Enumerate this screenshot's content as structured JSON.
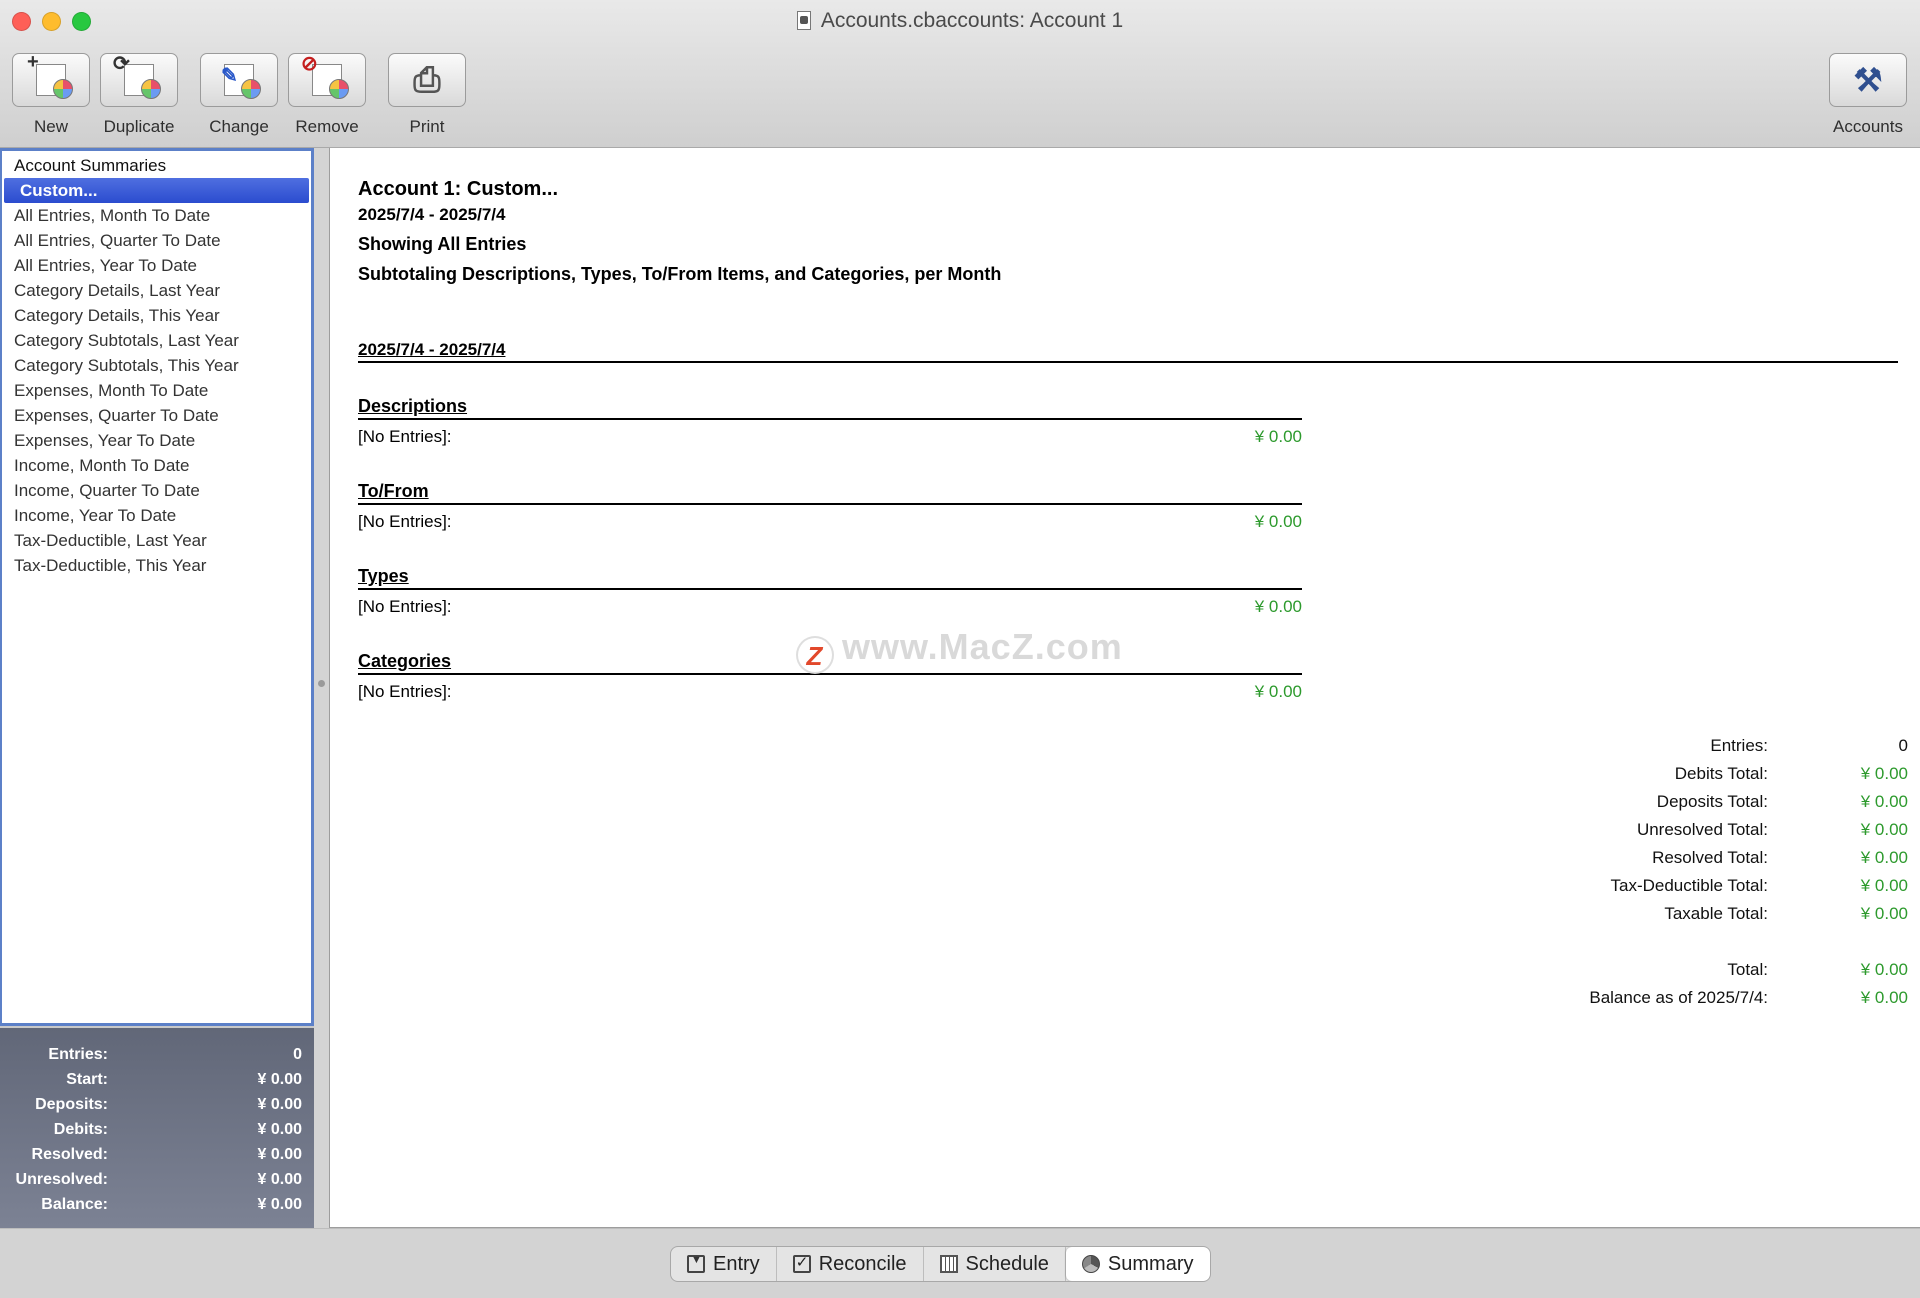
{
  "window": {
    "title": "Accounts.cbaccounts:  Account 1"
  },
  "toolbar": {
    "new_label": "New",
    "duplicate_label": "Duplicate",
    "change_label": "Change",
    "remove_label": "Remove",
    "print_label": "Print",
    "accounts_label": "Accounts"
  },
  "sidebar": {
    "header": "Account Summaries",
    "selected_index": 0,
    "items": [
      "Custom...",
      "All Entries, Month To Date",
      "All Entries, Quarter To Date",
      "All Entries, Year To Date",
      "Category Details, Last Year",
      "Category Details, This Year",
      "Category Subtotals, Last Year",
      "Category Subtotals, This Year",
      "Expenses, Month To Date",
      "Expenses, Quarter To Date",
      "Expenses, Year To Date",
      "Income, Month To Date",
      "Income, Quarter To Date",
      "Income, Year To Date",
      "Tax-Deductible, Last Year",
      "Tax-Deductible, This Year"
    ]
  },
  "stats": [
    {
      "label": "Entries:",
      "value": "0"
    },
    {
      "label": "Start:",
      "value": "¥ 0.00"
    },
    {
      "label": "Deposits:",
      "value": "¥ 0.00"
    },
    {
      "label": "Debits:",
      "value": "¥ 0.00"
    },
    {
      "label": "Resolved:",
      "value": "¥ 0.00"
    },
    {
      "label": "Unresolved:",
      "value": "¥ 0.00"
    },
    {
      "label": "Balance:",
      "value": "¥ 0.00"
    }
  ],
  "report": {
    "title": "Account 1:   Custom...",
    "date_range": "2025/7/4 - 2025/7/4",
    "showing": "Showing All Entries",
    "subtotaling": "Subtotaling Descriptions, Types, To/From Items, and Categories, per Month",
    "period": "2025/7/4 - 2025/7/4",
    "sections": [
      {
        "title": "Descriptions",
        "row_label": "[No Entries]:",
        "row_value": "¥ 0.00"
      },
      {
        "title": "To/From",
        "row_label": "[No Entries]:",
        "row_value": "¥ 0.00"
      },
      {
        "title": "Types",
        "row_label": "[No Entries]:",
        "row_value": "¥ 0.00"
      },
      {
        "title": "Categories",
        "row_label": "[No Entries]:",
        "row_value": "¥ 0.00"
      }
    ],
    "totals": [
      {
        "label": "Entries:",
        "value": "0"
      },
      {
        "label": "Debits Total:",
        "value": "¥ 0.00"
      },
      {
        "label": "Deposits Total:",
        "value": "¥ 0.00"
      },
      {
        "label": "Unresolved Total:",
        "value": "¥ 0.00"
      },
      {
        "label": "Resolved Total:",
        "value": "¥ 0.00"
      },
      {
        "label": "Tax-Deductible Total:",
        "value": "¥ 0.00"
      },
      {
        "label": "Taxable Total:",
        "value": "¥ 0.00"
      }
    ],
    "grand_totals": [
      {
        "label": "Total:",
        "value": "¥ 0.00"
      },
      {
        "label": "Balance as of 2025/7/4:",
        "value": "¥ 0.00"
      }
    ]
  },
  "watermark": {
    "logo": "Z",
    "text": "www.MacZ.com"
  },
  "tabs": [
    {
      "label": "Entry",
      "icon": "entry-icon"
    },
    {
      "label": "Reconcile",
      "icon": "checkbox-icon"
    },
    {
      "label": "Schedule",
      "icon": "calendar-grid-icon"
    },
    {
      "label": "Summary",
      "icon": "pie-chart-icon"
    }
  ],
  "active_tab": "Summary",
  "colors": {
    "selection": "#3a5bd6",
    "amount_green": "#2d9a2d",
    "stats_panel": "#6b7183"
  }
}
